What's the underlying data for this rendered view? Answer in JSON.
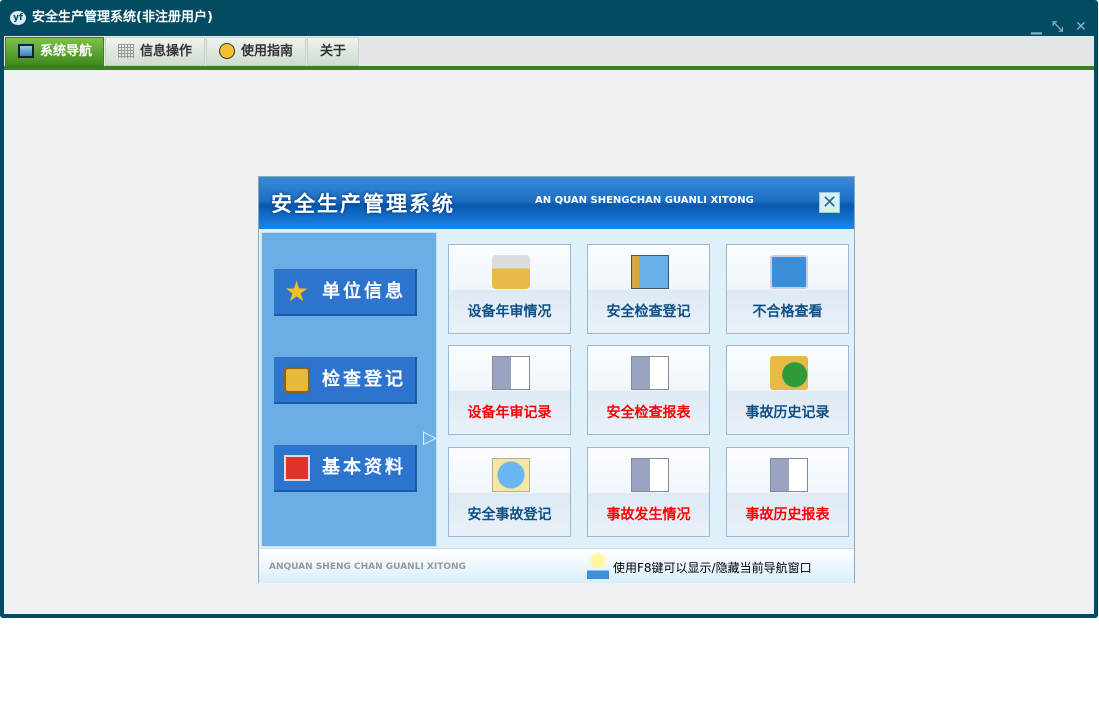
{
  "window": {
    "title": "安全生产管理系统(非注册用户)",
    "logo": "yf",
    "controls": [
      "minimize",
      "restore",
      "close"
    ]
  },
  "tabs": [
    {
      "label": "系统导航",
      "icon": "monitor-icon",
      "active": true
    },
    {
      "label": "信息操作",
      "icon": "grid-icon"
    },
    {
      "label": "使用指南",
      "icon": "help-icon"
    },
    {
      "label": "关于"
    }
  ],
  "dialog": {
    "title": "安全生产管理系统",
    "subtitle": "AN QUAN SHENGCHAN GUANLI XITONG",
    "close": "✕",
    "left_buttons": [
      {
        "label": "单位信息",
        "icon": "star-icon"
      },
      {
        "label": "检查登记",
        "icon": "document-icon",
        "selected": true
      },
      {
        "label": "基本资料",
        "icon": "monitor-icon"
      }
    ],
    "tiles": [
      {
        "label": "设备年审情况",
        "color": "blue",
        "icon": "gear-folder-icon"
      },
      {
        "label": "安全检查登记",
        "color": "blue",
        "icon": "chart-book-icon"
      },
      {
        "label": "不合格查看",
        "color": "blue",
        "icon": "magnifier-icon"
      },
      {
        "label": "设备年审记录",
        "color": "red",
        "icon": "folder-doc-icon"
      },
      {
        "label": "安全检查报表",
        "color": "red",
        "icon": "folder-doc-icon"
      },
      {
        "label": "事故历史记录",
        "color": "blue",
        "icon": "globe-folder-icon"
      },
      {
        "label": "安全事故登记",
        "color": "blue",
        "icon": "globe-paper-icon"
      },
      {
        "label": "事故发生情况",
        "color": "red",
        "icon": "folder-doc-icon"
      },
      {
        "label": "事故历史报表",
        "color": "red",
        "icon": "folder-doc-icon"
      }
    ],
    "footer_left": "ANQUAN SHENG CHAN GUANLI XITONG",
    "footer_hint": "使用F8键可以显示/隐藏当前导航窗口"
  }
}
